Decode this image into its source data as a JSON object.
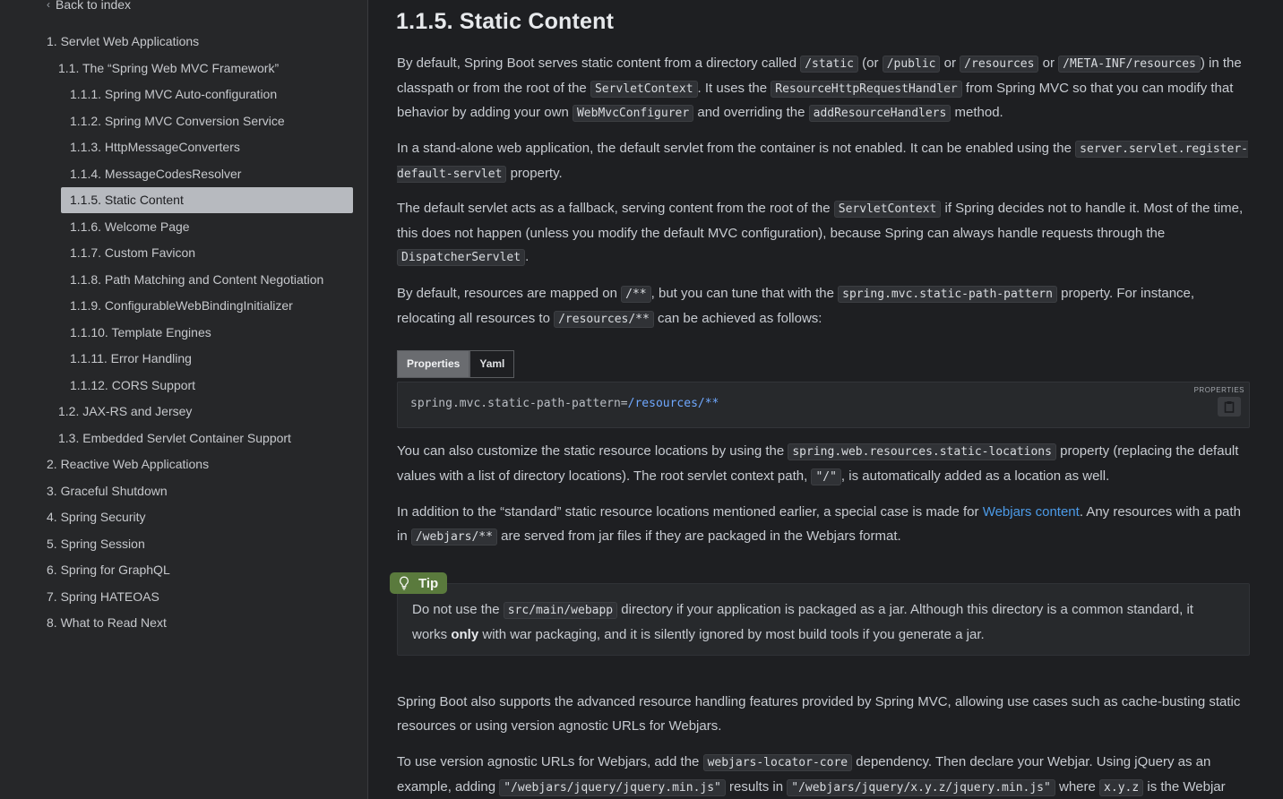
{
  "sidebar": {
    "back_label": "Back to index",
    "items": [
      {
        "label": "1. Servlet Web Applications"
      },
      {
        "label": "1.1. The “Spring Web MVC Framework”"
      },
      {
        "label": "1.1.1. Spring MVC Auto-configuration"
      },
      {
        "label": "1.1.2. Spring MVC Conversion Service"
      },
      {
        "label": "1.1.3. HttpMessageConverters"
      },
      {
        "label": "1.1.4. MessageCodesResolver"
      },
      {
        "label": "1.1.5. Static Content",
        "active": true
      },
      {
        "label": "1.1.6. Welcome Page"
      },
      {
        "label": "1.1.7. Custom Favicon"
      },
      {
        "label": "1.1.8. Path Matching and Content Negotiation"
      },
      {
        "label": "1.1.9. ConfigurableWebBindingInitializer"
      },
      {
        "label": "1.1.10. Template Engines"
      },
      {
        "label": "1.1.11. Error Handling"
      },
      {
        "label": "1.1.12. CORS Support"
      },
      {
        "label": "1.2. JAX-RS and Jersey"
      },
      {
        "label": "1.3. Embedded Servlet Container Support"
      },
      {
        "label": "2. Reactive Web Applications"
      },
      {
        "label": "3. Graceful Shutdown"
      },
      {
        "label": "4. Spring Security"
      },
      {
        "label": "5. Spring Session"
      },
      {
        "label": "6. Spring for GraphQL"
      },
      {
        "label": "7. Spring HATEOAS"
      },
      {
        "label": "8. What to Read Next"
      }
    ]
  },
  "content": {
    "heading": "1.1.5. Static Content",
    "p1": {
      "t1": "By default, Spring Boot serves static content from a directory called ",
      "c1": "/static",
      "t2": " (or ",
      "c2": "/public",
      "t3": " or ",
      "c3": "/resources",
      "t4": " or ",
      "c4": "/META-INF/resources",
      "t5": ") in the classpath or from the root of the ",
      "c5": "ServletContext",
      "t6": ". It uses the ",
      "c6": "ResourceHttpRequestHandler",
      "t7": " from Spring MVC so that you can modify that behavior by adding your own ",
      "c7": "WebMvcConfigurer",
      "t8": " and overriding the ",
      "c8": "addResourceHandlers",
      "t9": " method."
    },
    "p2": {
      "t1": "In a stand-alone web application, the default servlet from the container is not enabled. It can be enabled using the ",
      "c1": "server.servlet.register-default-servlet",
      "t2": " property."
    },
    "p3": {
      "t1": "The default servlet acts as a fallback, serving content from the root of the ",
      "c1": "ServletContext",
      "t2": " if Spring decides not to handle it. Most of the time, this does not happen (unless you modify the default MVC configuration), because Spring can always handle requests through the ",
      "c2": "DispatcherServlet",
      "t3": "."
    },
    "p4": {
      "t1": "By default, resources are mapped on ",
      "c1": "/**",
      "t2": ", but you can tune that with the ",
      "c2": "spring.mvc.static-path-pattern",
      "t3": " property. For instance, relocating all resources to ",
      "c3": "/resources/**",
      "t4": " can be achieved as follows:"
    },
    "tabs": {
      "properties": "Properties",
      "yaml": "Yaml"
    },
    "codeblock": {
      "key": "spring.mvc.static-path-pattern=",
      "value": "/resources/**",
      "lang": "PROPERTIES",
      "copy_icon": "clipboard-icon"
    },
    "p5": {
      "t1": "You can also customize the static resource locations by using the ",
      "c1": "spring.web.resources.static-locations",
      "t2": " property (replacing the default values with a list of directory locations). The root servlet context path, ",
      "c2": "\"/\"",
      "t3": ", is automatically added as a location as well."
    },
    "p6": {
      "t1": "In addition to the “standard” static resource locations mentioned earlier, a special case is made for ",
      "link": "Webjars content",
      "t2": ". Any resources with a path in ",
      "c1": "/webjars/**",
      "t3": " are served from jar files if they are packaged in the Webjars format."
    },
    "tip": {
      "label": "Tip",
      "icon": "lightbulb-icon",
      "t1": "Do not use the ",
      "c1": "src/main/webapp",
      "t2": " directory if your application is packaged as a jar. Although this directory is a common standard, it works ",
      "strong": "only",
      "t3": " with war packaging, and it is silently ignored by most build tools if you generate a jar."
    },
    "p7": {
      "t1": "Spring Boot also supports the advanced resource handling features provided by Spring MVC, allowing use cases such as cache-busting static resources or using version agnostic URLs for Webjars."
    },
    "p8": {
      "t1": "To use version agnostic URLs for Webjars, add the ",
      "c1": "webjars-locator-core",
      "t2": " dependency. Then declare your Webjar. Using jQuery as an example, adding ",
      "c2": "\"/webjars/jquery/jquery.min.js\"",
      "t3": " results in ",
      "c3": "\"/webjars/jquery/x.y.z/jquery.min.js\"",
      "t4": " where ",
      "c4": "x.y.z",
      "t5": " is the Webjar"
    }
  }
}
